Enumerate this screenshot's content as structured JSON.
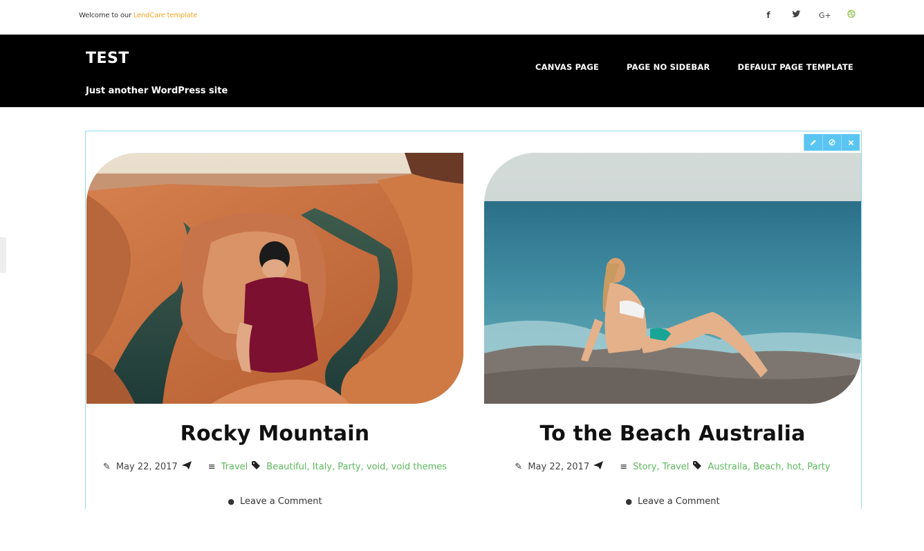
{
  "topbar": {
    "welcome_prefix": "Welcome to our ",
    "welcome_link": "LendCare template",
    "social": [
      {
        "icon": "facebook-icon",
        "glyph": "f"
      },
      {
        "icon": "twitter-icon",
        "glyph": "❀"
      },
      {
        "icon": "google-plus-icon",
        "glyph": "G+"
      },
      {
        "icon": "dribbble-icon",
        "glyph": "❂"
      }
    ]
  },
  "header": {
    "site_title": "TEST",
    "tagline": "Just another WordPress site",
    "nav": [
      "CANVAS PAGE",
      "PAGE NO SIDEBAR",
      "DEFAULT PAGE TEMPLATE"
    ]
  },
  "colors": {
    "header_bg": "#000000",
    "accent_link": "#f5a623",
    "meta_green": "#5cb85c",
    "edit_blue": "#5bc5f2"
  },
  "edit_tools": [
    "pencil-icon",
    "duplicate-icon",
    "close-icon"
  ],
  "posts": [
    {
      "title": "Rocky Mountain",
      "date": "May 22, 2017",
      "categories": "Travel",
      "tags": "Beautiful, Italy, Party, void, void themes",
      "comment": "Leave a Comment"
    },
    {
      "title": "To the Beach Australia",
      "date": "May 22, 2017",
      "categories": "Story, Travel",
      "tags": "Austraila, Beach, hot, Party",
      "comment": "Leave a Comment"
    }
  ]
}
